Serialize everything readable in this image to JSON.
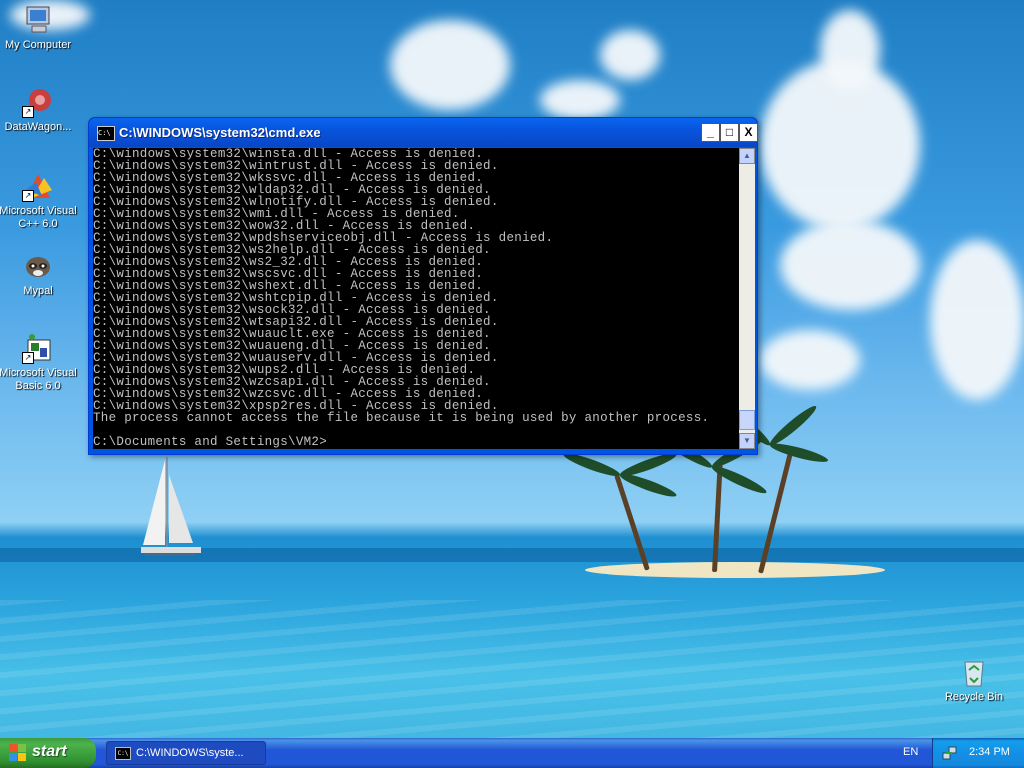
{
  "desktop": {
    "icons": [
      {
        "label": "My Computer"
      },
      {
        "label": "DataWagon..."
      },
      {
        "label": "Microsoft Visual C++ 6.0"
      },
      {
        "label": "Mypal"
      },
      {
        "label": "Microsoft Visual Basic 6.0"
      },
      {
        "label": "Recycle Bin"
      }
    ]
  },
  "cmd_window": {
    "title": "C:\\WINDOWS\\system32\\cmd.exe",
    "icon_text": "C:\\",
    "buttons": {
      "minimize": "_",
      "maximize": "□",
      "close": "X"
    },
    "lines": [
      "C:\\windows\\system32\\winsta.dll - Access is denied.",
      "C:\\windows\\system32\\wintrust.dll - Access is denied.",
      "C:\\windows\\system32\\wkssvc.dll - Access is denied.",
      "C:\\windows\\system32\\wldap32.dll - Access is denied.",
      "C:\\windows\\system32\\wlnotify.dll - Access is denied.",
      "C:\\windows\\system32\\wmi.dll - Access is denied.",
      "C:\\windows\\system32\\wow32.dll - Access is denied.",
      "C:\\windows\\system32\\wpdshserviceobj.dll - Access is denied.",
      "C:\\windows\\system32\\ws2help.dll - Access is denied.",
      "C:\\windows\\system32\\ws2_32.dll - Access is denied.",
      "C:\\windows\\system32\\wscsvc.dll - Access is denied.",
      "C:\\windows\\system32\\wshext.dll - Access is denied.",
      "C:\\windows\\system32\\wshtcpip.dll - Access is denied.",
      "C:\\windows\\system32\\wsock32.dll - Access is denied.",
      "C:\\windows\\system32\\wtsapi32.dll - Access is denied.",
      "C:\\windows\\system32\\wuauclt.exe - Access is denied.",
      "C:\\windows\\system32\\wuaueng.dll - Access is denied.",
      "C:\\windows\\system32\\wuauserv.dll - Access is denied.",
      "C:\\windows\\system32\\wups2.dll - Access is denied.",
      "C:\\windows\\system32\\wzcsapi.dll - Access is denied.",
      "C:\\windows\\system32\\wzcsvc.dll - Access is denied.",
      "C:\\windows\\system32\\xpsp2res.dll - Access is denied.",
      "The process cannot access the file because it is being used by another process.",
      "",
      "C:\\Documents and Settings\\VM2>"
    ],
    "colors": {
      "background": "#000000",
      "text": "#c0c0c0"
    }
  },
  "taskbar": {
    "start_label": "start",
    "task_items": [
      {
        "label": "C:\\WINDOWS\\syste..."
      }
    ],
    "language": "EN",
    "clock": "2:34 PM"
  },
  "colors": {
    "titlebar": "#0855dd",
    "taskbar": "#2157d7",
    "start_button": "#3c9a3c",
    "tray": "#1290e8"
  }
}
